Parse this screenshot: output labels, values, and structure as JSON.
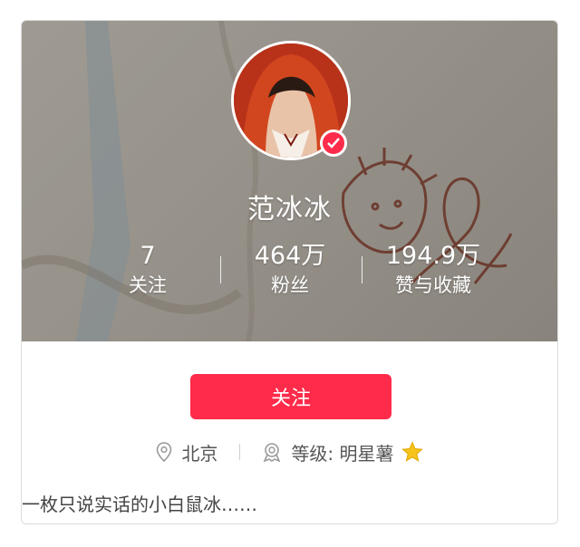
{
  "profile": {
    "name": "范冰冰",
    "bio": "一枚只说实话的小白鼠冰……",
    "location": "北京",
    "level_label": "等级: 明星薯"
  },
  "stats": [
    {
      "value": "7",
      "label": "关注"
    },
    {
      "value": "464万",
      "label": "粉丝"
    },
    {
      "value": "194.9万",
      "label": "赞与收藏"
    }
  ],
  "actions": {
    "follow_label": "关注"
  },
  "icons": {
    "location": "location-pin-icon",
    "level": "level-badge-icon",
    "level_star": "star-icon",
    "verified": "verified-check-icon"
  },
  "colors": {
    "accent": "#ff2b4a",
    "star": "#f7c21a"
  }
}
